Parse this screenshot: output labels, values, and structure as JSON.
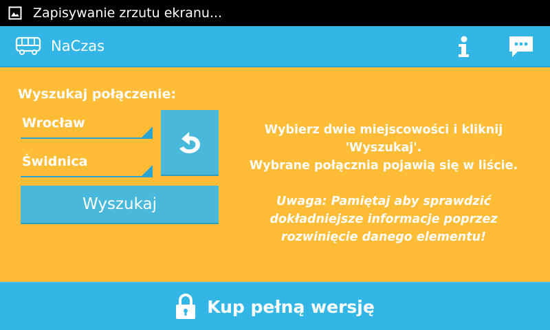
{
  "status_bar": {
    "notification_text": "Zapisywanie zrzutu ekranu...",
    "icon": "image-icon"
  },
  "action_bar": {
    "app_name": "NaCzas",
    "app_icon": "bus-icon",
    "actions": [
      "info-icon",
      "chat-icon"
    ]
  },
  "search": {
    "heading": "Wyszukaj połączenie:",
    "from_value": "Wrocław",
    "to_value": "Świdnica",
    "swap_icon": "swap-arrow-icon",
    "search_button_label": "Wyszukaj"
  },
  "info": {
    "instructions": "Wybierz dwie miejscowości i kliknij\n'Wyszukaj'.\nWybrane połącznia pojawią się w liście.",
    "warning": "Uwaga: Pamiętaj aby sprawdzić\ndokładniejsze informacje poprzez\nrozwinięcie danego elementu!"
  },
  "footer": {
    "buy_label": "Kup pełną wersję",
    "icon": "lock-icon"
  },
  "colors": {
    "accent": "#33b6e6",
    "background": "#ffbc36",
    "button": "#48b8db"
  }
}
